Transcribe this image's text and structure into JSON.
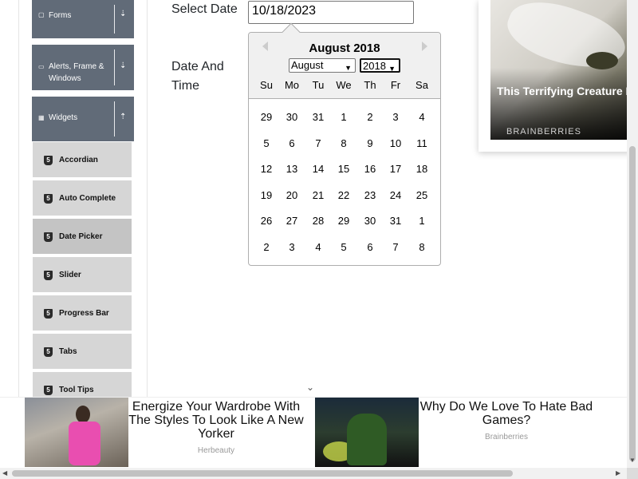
{
  "sidebar": {
    "groups": [
      {
        "label": "Forms",
        "toggle": "⇣"
      },
      {
        "label": "Alerts, Frame & Windows",
        "toggle": "⇣"
      },
      {
        "label": "Widgets",
        "toggle": "⇡"
      }
    ],
    "items": [
      {
        "label": "Accordian"
      },
      {
        "label": "Auto Complete"
      },
      {
        "label": "Date Picker"
      },
      {
        "label": "Slider"
      },
      {
        "label": "Progress Bar"
      },
      {
        "label": "Tabs"
      },
      {
        "label": "Tool Tips"
      }
    ]
  },
  "main": {
    "select_date_label": "Select Date",
    "date_time_label": "Date And Time",
    "date_value": "10/18/2023"
  },
  "calendar": {
    "title": "August 2018",
    "month_select": "August",
    "year_select": "2018",
    "weekdays": [
      "Su",
      "Mo",
      "Tu",
      "We",
      "Th",
      "Fr",
      "Sa"
    ],
    "weeks": [
      [
        "29",
        "30",
        "31",
        "1",
        "2",
        "3",
        "4"
      ],
      [
        "5",
        "6",
        "7",
        "8",
        "9",
        "10",
        "11"
      ],
      [
        "12",
        "13",
        "14",
        "15",
        "16",
        "17",
        "18"
      ],
      [
        "19",
        "20",
        "21",
        "22",
        "23",
        "24",
        "25"
      ],
      [
        "26",
        "27",
        "28",
        "29",
        "30",
        "31",
        "1"
      ],
      [
        "2",
        "3",
        "4",
        "5",
        "6",
        "7",
        "8"
      ]
    ]
  },
  "ad_top": {
    "title": "This Terrifying Creature Is The Largest Flying Insect Ever",
    "brand": "BRAINBERRIES"
  },
  "ad_bottom": {
    "left_title": "Energize Your Wardrobe With The Styles To Look Like A New Yorker",
    "left_source": "Herbeauty",
    "right_title": "Why Do We Love To Hate Bad Games?",
    "right_source": "Brainberries"
  },
  "scroll_hint_icon": "chevron-down-icon"
}
